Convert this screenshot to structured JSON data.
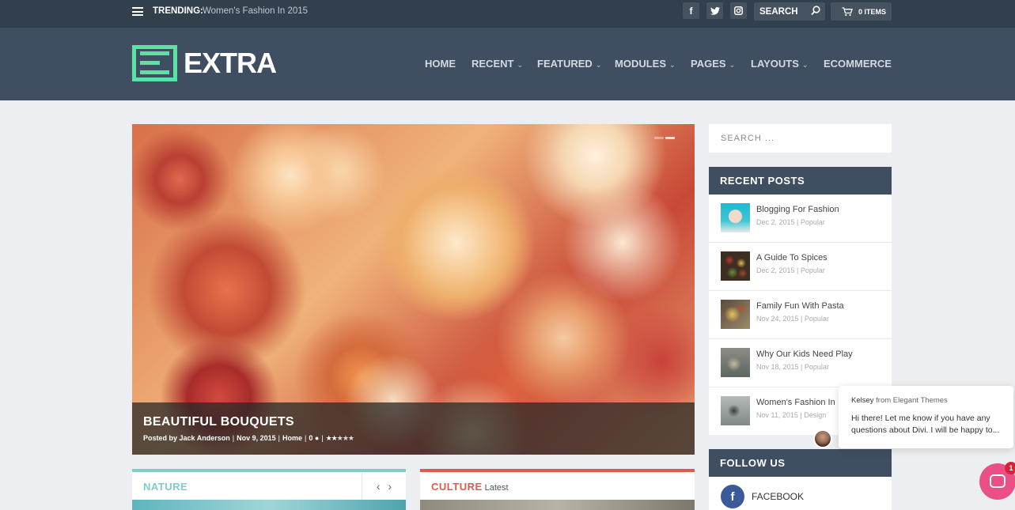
{
  "topbar": {
    "trending_label": "TRENDING:",
    "trending_text": "Women's Fashion In 2015",
    "search_label": "SEARCH",
    "cart_label": "0 ITEMS",
    "social": [
      "facebook-icon",
      "twitter-icon",
      "instagram-icon"
    ]
  },
  "header": {
    "logo_text": "EXTRA",
    "logo_color": "#5be0a5",
    "nav": [
      {
        "label": "HOME",
        "has_dropdown": false
      },
      {
        "label": "RECENT",
        "has_dropdown": true
      },
      {
        "label": "FEATURED",
        "has_dropdown": true
      },
      {
        "label": "MODULES",
        "has_dropdown": true
      },
      {
        "label": "PAGES",
        "has_dropdown": true
      },
      {
        "label": "LAYOUTS",
        "has_dropdown": true
      },
      {
        "label": "ECOMMERCE",
        "has_dropdown": false
      }
    ]
  },
  "hero": {
    "title": "BEAUTIFUL BOUQUETS",
    "author_prefix": "Posted by",
    "author": "Jack Anderson",
    "date": "Nov 9, 2015",
    "category": "Home",
    "comments": "0",
    "rating": 2.5
  },
  "modules": [
    {
      "title": "NATURE",
      "subtitle": "",
      "accent": "#7ecccc"
    },
    {
      "title": "CULTURE",
      "subtitle": "Latest",
      "accent": "#e2584b"
    }
  ],
  "sidebar": {
    "search_placeholder": "SEARCH ...",
    "recent_posts_title": "RECENT POSTS",
    "recent_posts": [
      {
        "title": "Blogging For Fashion",
        "date": "Dec 2, 2015",
        "category": "Popular"
      },
      {
        "title": "A Guide To Spices",
        "date": "Dec 2, 2015",
        "category": "Popular"
      },
      {
        "title": "Family Fun With Pasta",
        "date": "Nov 24, 2015",
        "category": "Popular"
      },
      {
        "title": "Why Our Kids Need Play",
        "date": "Nov 18, 2015",
        "category": "Popular"
      },
      {
        "title": "Women's Fashion In",
        "date": "Nov 11, 2015",
        "category": "Design"
      }
    ],
    "follow_title": "FOLLOW US",
    "follow_items": [
      {
        "label": "FACEBOOK",
        "icon": "facebook-icon",
        "color": "#3b5a99"
      }
    ]
  },
  "chat": {
    "sender": "Kelsey",
    "from_text": "from Elegant Themes",
    "message": "Hi there! Let me know if you have any questions about Divi. I will be happy to...",
    "unread_count": "1"
  },
  "colors": {
    "topbar": "#323f4d",
    "header": "#3f4f61",
    "page_bg": "#eceef1",
    "chat_launcher": "#ea4f86"
  }
}
